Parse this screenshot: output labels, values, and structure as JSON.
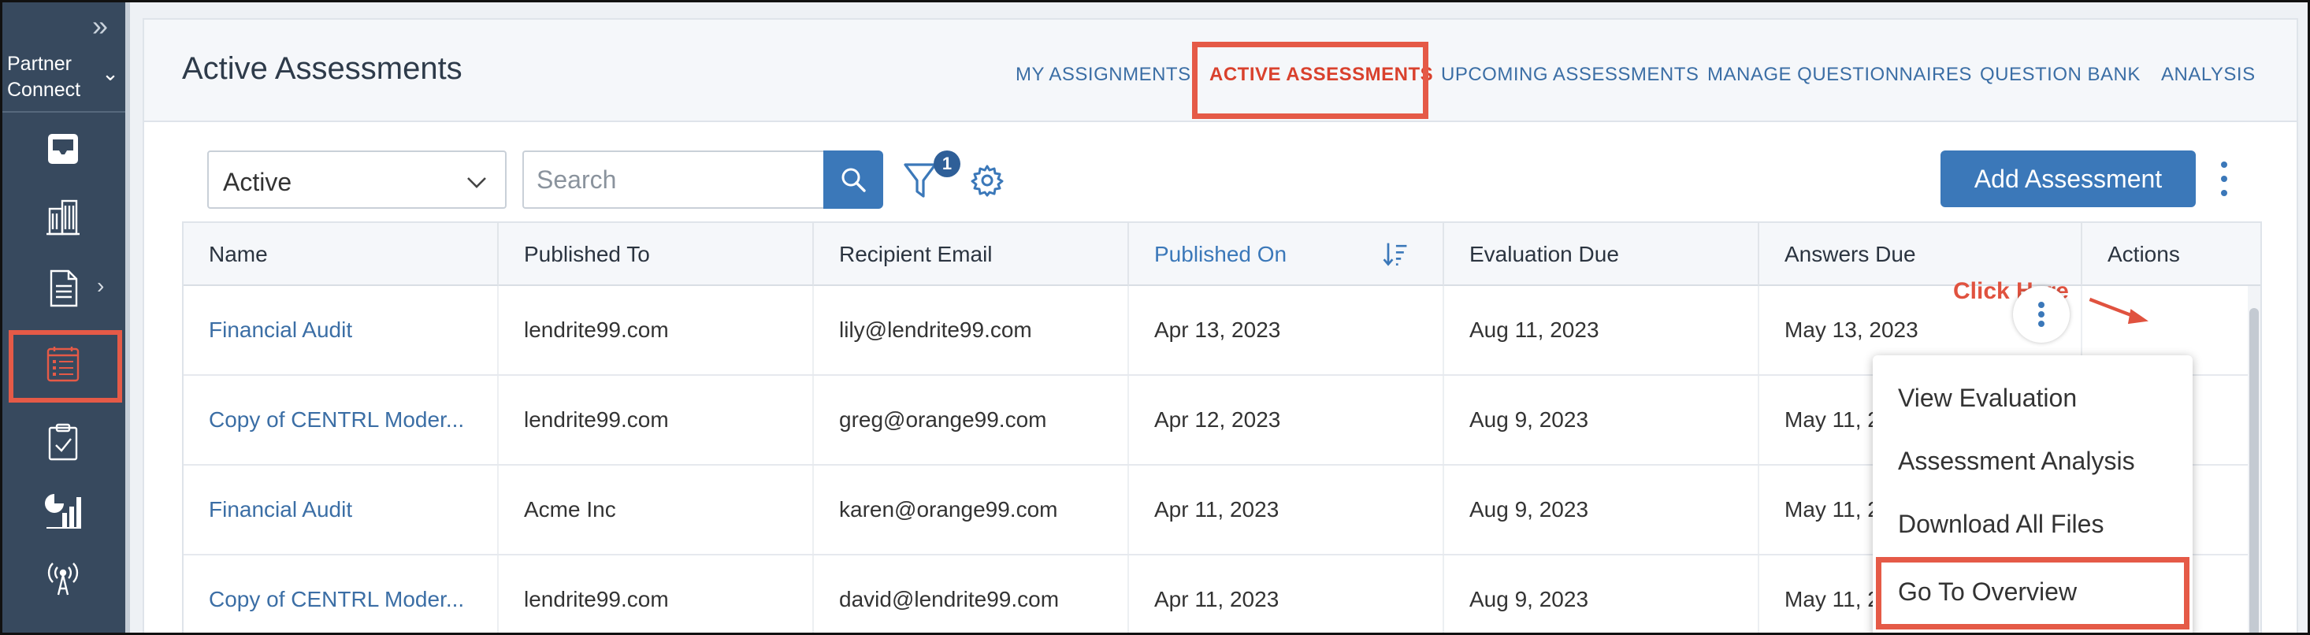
{
  "sidebar": {
    "brand": "Partner Connect",
    "items": [
      {
        "icon": "inbox-icon"
      },
      {
        "icon": "building-icon"
      },
      {
        "icon": "document-icon"
      },
      {
        "icon": "assessment-list-icon",
        "active": true
      },
      {
        "icon": "clipboard-check-icon"
      },
      {
        "icon": "analytics-chart-icon"
      },
      {
        "icon": "broadcast-tower-icon"
      }
    ]
  },
  "header": {
    "title": "Active Assessments",
    "tabs": [
      {
        "label": "MY ASSIGNMENTS"
      },
      {
        "label": "ACTIVE ASSESSMENTS",
        "active": true
      },
      {
        "label": "UPCOMING ASSESSMENTS"
      },
      {
        "label": "MANAGE QUESTIONNAIRES"
      },
      {
        "label": "QUESTION BANK"
      },
      {
        "label": "ANALYSIS"
      }
    ]
  },
  "toolbar": {
    "status_value": "Active",
    "search_placeholder": "Search",
    "filter_count": "1",
    "add_label": "Add Assessment"
  },
  "table": {
    "columns": [
      "Name",
      "Published To",
      "Recipient Email",
      "Published On",
      "Evaluation Due",
      "Answers Due",
      "Actions"
    ],
    "sorted_column": "Published On",
    "rows": [
      {
        "name": "Financial Audit",
        "published_to": "lendrite99.com",
        "email": "lily@lendrite99.com",
        "published_on": "Apr 13, 2023",
        "evaluation_due": "Aug 11, 2023",
        "answers_due": "May 13, 2023"
      },
      {
        "name": "Copy of CENTRL Moder...",
        "published_to": "lendrite99.com",
        "email": "greg@orange99.com",
        "published_on": "Apr 12, 2023",
        "evaluation_due": "Aug 9, 2023",
        "answers_due": "May 11, 2"
      },
      {
        "name": "Financial Audit",
        "published_to": "Acme Inc",
        "email": "karen@orange99.com",
        "published_on": "Apr 11, 2023",
        "evaluation_due": "Aug 9, 2023",
        "answers_due": "May 11, 2"
      },
      {
        "name": "Copy of CENTRL Moder...",
        "published_to": "lendrite99.com",
        "email": "david@lendrite99.com",
        "published_on": "Apr 11, 2023",
        "evaluation_due": "Aug 9, 2023",
        "answers_due": "May 11, 2"
      }
    ]
  },
  "annotation": {
    "text": "Click Here",
    "color": "#e0523f"
  },
  "actions_menu": {
    "items": [
      "View Evaluation",
      "Assessment Analysis",
      "Download All Files",
      "Go To Overview"
    ],
    "highlighted": "Go To Overview"
  },
  "colors": {
    "sidebar": "#37495e",
    "accent": "#3b78b9",
    "highlight": "#e55a47",
    "link": "#3b6ea5"
  }
}
